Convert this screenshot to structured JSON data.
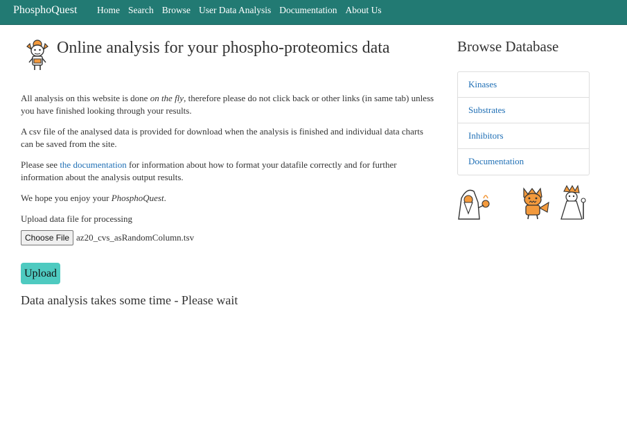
{
  "navbar": {
    "brand": "PhosphoQuest",
    "links": [
      "Home",
      "Search",
      "Browse",
      "User Data Analysis",
      "Documentation",
      "About Us"
    ]
  },
  "main": {
    "title": "Online analysis for your phospho-proteomics data",
    "para1_prefix": "All analysis on this website is done ",
    "para1_italic": "on the fly",
    "para1_suffix": ", therefore please do not click back or other links (in same tab) unless you have finished looking through your results.",
    "para2": "A csv file of the analysed data is provided for download when the analysis is finished and individual data charts can be saved from the site.",
    "para3_prefix": "Please see ",
    "para3_link": "the documentation",
    "para3_suffix": " for information about how to format your datafile correctly and for further information about the analysis output results.",
    "para4_prefix": "We hope you enjoy your ",
    "para4_italic": "PhosphoQuest",
    "para4_suffix": ".",
    "upload_label": "Upload data file for processing",
    "choose_file_label": "Choose File",
    "file_name": "az20_cvs_asRandomColumn.tsv",
    "upload_button": "Upload",
    "wait_message": "Data analysis takes some time - Please wait"
  },
  "sidebar": {
    "title": "Browse Database",
    "items": [
      "Kinases",
      "Substrates",
      "Inhibitors",
      "Documentation"
    ]
  },
  "colors": {
    "navbar": "#227a73",
    "link": "#1f6fb5",
    "upload_button": "#4ecac0",
    "mascot_orange": "#f39a3d"
  },
  "icons": [
    "cartoon-creature-logo-icon",
    "wizard-icon",
    "monster-icon",
    "sorcerer-icon"
  ]
}
